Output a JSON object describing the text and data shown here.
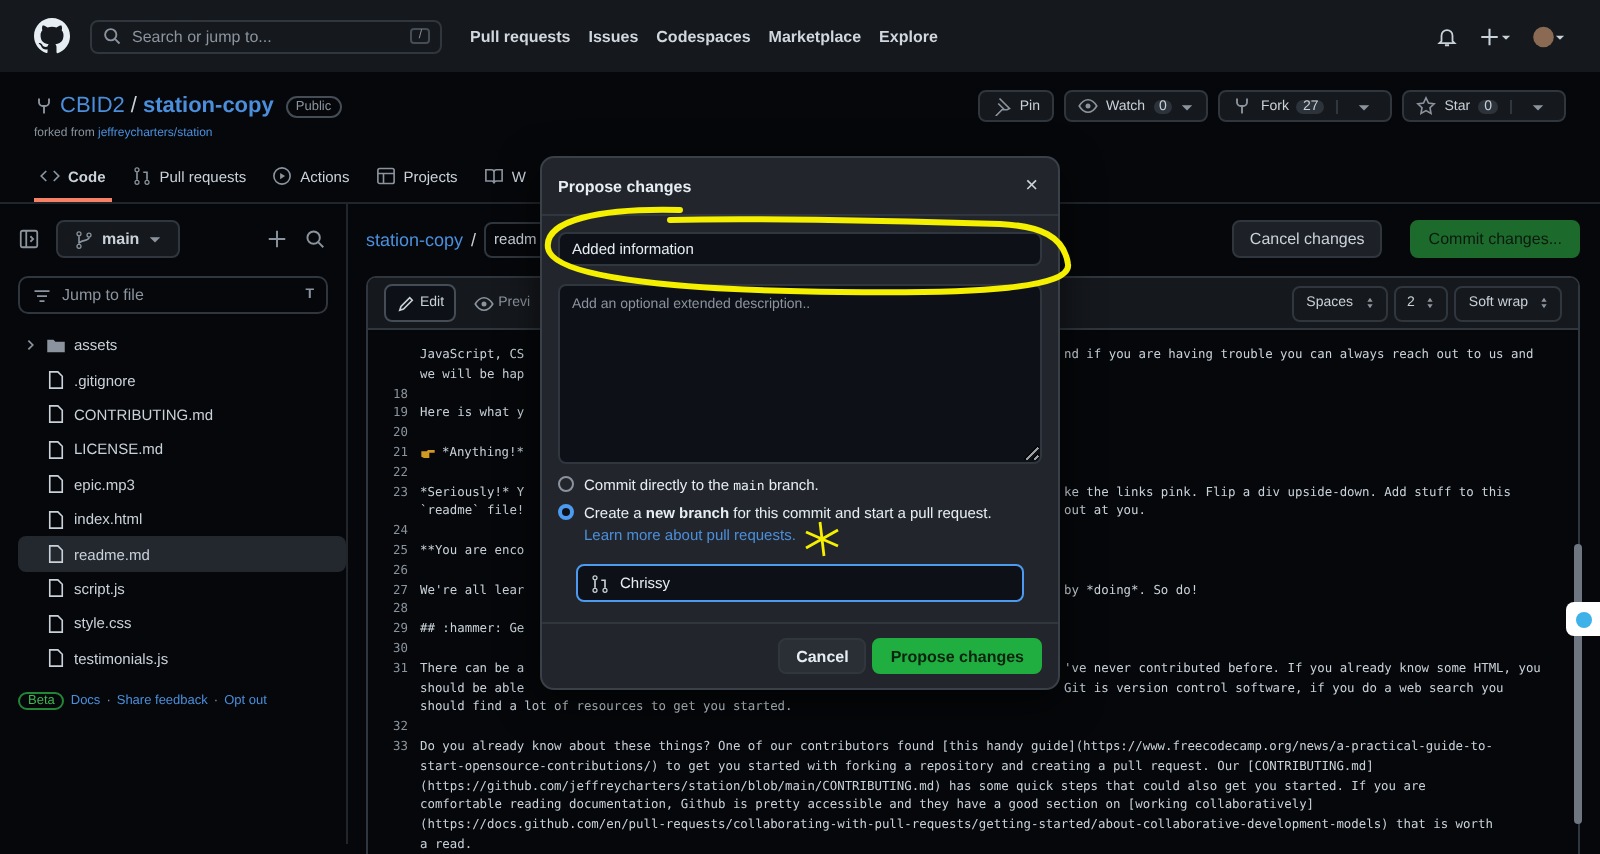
{
  "header": {
    "search": {
      "placeholder": "Search or jump to...",
      "shortcut": "/"
    },
    "nav": [
      "Pull requests",
      "Issues",
      "Codespaces",
      "Marketplace",
      "Explore"
    ]
  },
  "repo": {
    "owner": "CBID2",
    "separator": "/",
    "name": "station-copy",
    "visibility": "Public",
    "forked_prefix": "forked from",
    "forked_source": "jeffreycharters/station",
    "actions": [
      {
        "kind": "pin",
        "label": "Pin"
      },
      {
        "kind": "watch",
        "label": "Watch",
        "count": "0"
      },
      {
        "kind": "fork",
        "label": "Fork",
        "count": "27"
      },
      {
        "kind": "star",
        "label": "Star",
        "count": "0"
      }
    ],
    "tabs": [
      {
        "label": "Code",
        "selected": true
      },
      {
        "label": "Pull requests",
        "selected": false
      },
      {
        "label": "Actions",
        "selected": false
      },
      {
        "label": "Projects",
        "selected": false
      },
      {
        "label": "W",
        "selected": false
      }
    ]
  },
  "sidebar": {
    "branch": "main",
    "filter": {
      "placeholder": "Jump to file",
      "shortcut": "T"
    },
    "files": [
      {
        "kind": "folder",
        "name": "assets",
        "selected": false
      },
      {
        "kind": "file",
        "name": ".gitignore",
        "selected": false
      },
      {
        "kind": "file",
        "name": "CONTRIBUTING.md",
        "selected": false
      },
      {
        "kind": "file",
        "name": "LICENSE.md",
        "selected": false
      },
      {
        "kind": "file",
        "name": "epic.mp3",
        "selected": false
      },
      {
        "kind": "file",
        "name": "index.html",
        "selected": false
      },
      {
        "kind": "file",
        "name": "readme.md",
        "selected": true
      },
      {
        "kind": "file",
        "name": "script.js",
        "selected": false
      },
      {
        "kind": "file",
        "name": "style.css",
        "selected": false
      },
      {
        "kind": "file",
        "name": "testimonials.js",
        "selected": false
      }
    ],
    "footer": {
      "badge": "Beta",
      "separator": "·",
      "links": [
        "Docs",
        "Share feedback",
        "Opt out"
      ]
    }
  },
  "editor": {
    "breadcrumb": "station-copy",
    "separator": "/",
    "filename": "readm",
    "cancel": "Cancel changes",
    "commit": "Commit changes...",
    "tabs": [
      {
        "label": "Edit",
        "selected": true
      },
      {
        "label": "Previ",
        "selected": false
      }
    ],
    "selects": [
      "Spaces",
      "2",
      "Soft wrap"
    ],
    "lines": [
      {
        "left": "JavaScript, CS",
        "right": "nd if you are having trouble you can always reach out to us and"
      },
      {
        "left": "we will be hap"
      },
      {
        "number": "18"
      },
      {
        "number": "19",
        "left": "Here is what y"
      },
      {
        "number": "20"
      },
      {
        "number": "21",
        "left": "*Anything!*"
      },
      {
        "number": "22"
      },
      {
        "number": "23",
        "left": "*Seriously!* Y",
        "right": "ke the links pink. Flip a div upside-down. Add stuff to this"
      },
      {
        "left": "`readme` file!",
        "right": "out at you."
      },
      {
        "number": "24"
      },
      {
        "number": "25",
        "left": "**You are enco"
      },
      {
        "number": "26"
      },
      {
        "number": "27",
        "left": "We're all lear",
        "right": "by *doing*. So do!"
      },
      {
        "number": "28"
      },
      {
        "number": "29",
        "left": "## :hammer: Ge"
      },
      {
        "number": "30"
      },
      {
        "number": "31",
        "left": "There can be a",
        "right": "'ve never contributed before. If you already know some HTML, you"
      },
      {
        "left": "should be able",
        "right": "Git is version control software, if you do a web search you"
      },
      {
        "left": "should find a lot of resources to get you started."
      },
      {
        "number": "32"
      },
      {
        "number": "33",
        "left": "Do you already know about these things? One of our contributors found [this handy guide](https://www.freecodecamp.org/news/a-practical-guide-to-"
      },
      {
        "left": "start-opensource-contributions/) to get you started with forking a repository and creating a pull request. Our [CONTRIBUTING.md]"
      },
      {
        "left": "(https://github.com/jeffreycharters/station/blob/main/CONTRIBUTING.md) has some quick steps that could also get you started. If you are"
      },
      {
        "left": "comfortable reading documentation, Github is pretty accessible and they have a good section on [working collaboratively]"
      },
      {
        "left": "(https://docs.github.com/en/pull-requests/collaborating-with-pull-requests/getting-started/about-collaborative-development-models) that is worth"
      },
      {
        "left": "a read."
      }
    ]
  },
  "dialog": {
    "title": "Propose changes",
    "close": "×",
    "summary": "Added information",
    "description_placeholder": "Add an optional extended description..",
    "options": [
      {
        "before": "Commit directly to the",
        "code": "main",
        "after": "branch.",
        "selected": false
      },
      {
        "text": "Create a **new branch** for this commit and start a pull request.",
        "link": "Learn more about pull requests.",
        "selected": true
      }
    ],
    "branch": "Chrissy",
    "cancel": "Cancel",
    "submit": "Propose changes"
  }
}
